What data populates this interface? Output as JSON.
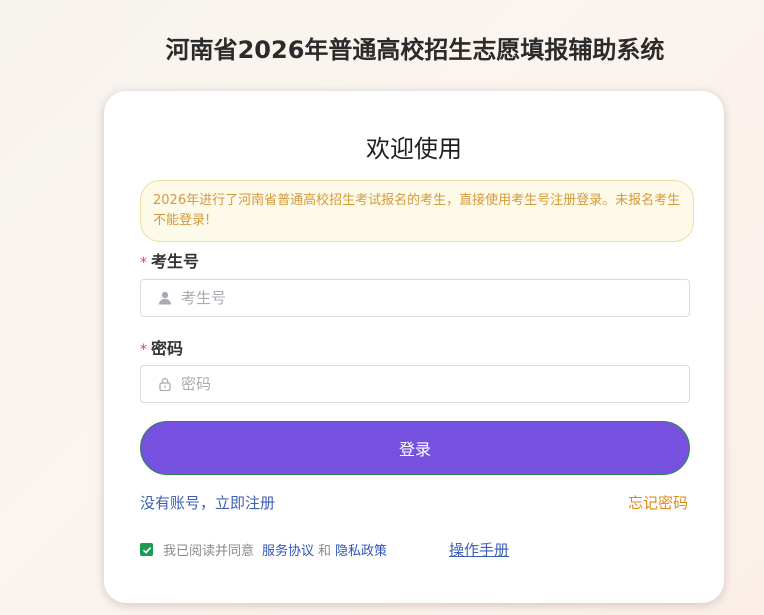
{
  "header": {
    "title": "河南省2026年普通高校招生志愿填报辅助系统"
  },
  "card": {
    "welcome": "欢迎使用",
    "notice": "2026年进行了河南省普通高校招生考试报名的考生，直接使用考生号注册登录。未报名考生不能登录!",
    "exam_number": {
      "required_mark": "*",
      "label": "考生号",
      "placeholder": "考生号",
      "value": "",
      "icon": "user-icon"
    },
    "password": {
      "required_mark": "*",
      "label": "密码",
      "placeholder": "密码",
      "value": "",
      "icon": "lock-icon"
    },
    "login_button": "登录",
    "register_link": "没有账号，立即注册",
    "forgot_link": "忘记密码",
    "agreement": {
      "checked": true,
      "prefix": "我已阅读并同意",
      "service": "服务协议",
      "and": "和",
      "privacy": "隐私政策"
    },
    "manual_link": "操作手册"
  },
  "colors": {
    "primary_button": "#7651df",
    "link_blue": "#3b5eb6",
    "forgot_orange": "#df8a1d",
    "notice_text": "#d59a3c",
    "checkbox_green": "#1b9b55"
  }
}
